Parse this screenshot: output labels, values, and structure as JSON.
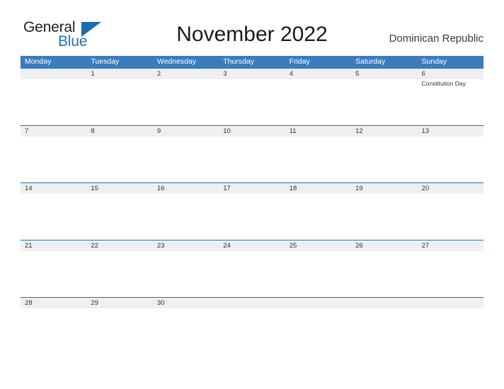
{
  "logo": {
    "word_one": "General",
    "word_two": "Blue",
    "flag_icon": "triangle-flag-icon",
    "dark_color": "#231f20",
    "blue_color": "#1f72b8"
  },
  "header": {
    "title": "November 2022",
    "country": "Dominican Republic"
  },
  "colors": {
    "header_blue": "#3b7cbe",
    "row_band": "#efefef",
    "rule_blue": "#2f6ea5",
    "page_background": "#ffffff"
  },
  "calendar": {
    "weekdays": [
      "Monday",
      "Tuesday",
      "Wednesday",
      "Thursday",
      "Friday",
      "Saturday",
      "Sunday"
    ],
    "weeks": [
      {
        "days": [
          {
            "number": "",
            "event": ""
          },
          {
            "number": "1",
            "event": ""
          },
          {
            "number": "2",
            "event": ""
          },
          {
            "number": "3",
            "event": ""
          },
          {
            "number": "4",
            "event": ""
          },
          {
            "number": "5",
            "event": ""
          },
          {
            "number": "6",
            "event": "Constitution Day"
          }
        ]
      },
      {
        "days": [
          {
            "number": "7",
            "event": ""
          },
          {
            "number": "8",
            "event": ""
          },
          {
            "number": "9",
            "event": ""
          },
          {
            "number": "10",
            "event": ""
          },
          {
            "number": "11",
            "event": ""
          },
          {
            "number": "12",
            "event": ""
          },
          {
            "number": "13",
            "event": ""
          }
        ]
      },
      {
        "days": [
          {
            "number": "14",
            "event": ""
          },
          {
            "number": "15",
            "event": ""
          },
          {
            "number": "16",
            "event": ""
          },
          {
            "number": "17",
            "event": ""
          },
          {
            "number": "18",
            "event": ""
          },
          {
            "number": "19",
            "event": ""
          },
          {
            "number": "20",
            "event": ""
          }
        ]
      },
      {
        "days": [
          {
            "number": "21",
            "event": ""
          },
          {
            "number": "22",
            "event": ""
          },
          {
            "number": "23",
            "event": ""
          },
          {
            "number": "24",
            "event": ""
          },
          {
            "number": "25",
            "event": ""
          },
          {
            "number": "26",
            "event": ""
          },
          {
            "number": "27",
            "event": ""
          }
        ]
      },
      {
        "days": [
          {
            "number": "28",
            "event": ""
          },
          {
            "number": "29",
            "event": ""
          },
          {
            "number": "30",
            "event": ""
          },
          {
            "number": "",
            "event": ""
          },
          {
            "number": "",
            "event": ""
          },
          {
            "number": "",
            "event": ""
          },
          {
            "number": "",
            "event": ""
          }
        ]
      }
    ]
  }
}
